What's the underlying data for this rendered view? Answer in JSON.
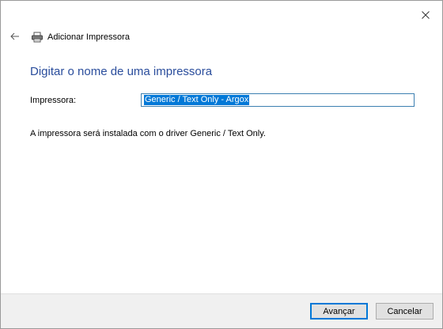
{
  "window": {
    "title": "Adicionar Impressora",
    "close_icon": "close-icon",
    "back_icon": "back-arrow-icon",
    "title_icon": "printer-icon"
  },
  "main": {
    "heading": "Digitar o nome de uma impressora",
    "printer_label": "Impressora:",
    "printer_value": "Generic / Text Only - Argox",
    "info": "A impressora será instalada com o driver Generic / Text Only."
  },
  "footer": {
    "next_label": "Avançar",
    "cancel_label": "Cancelar"
  },
  "colors": {
    "heading": "#2a4d9c",
    "selection": "#0078d7",
    "footer_bg": "#f0f0f0"
  }
}
